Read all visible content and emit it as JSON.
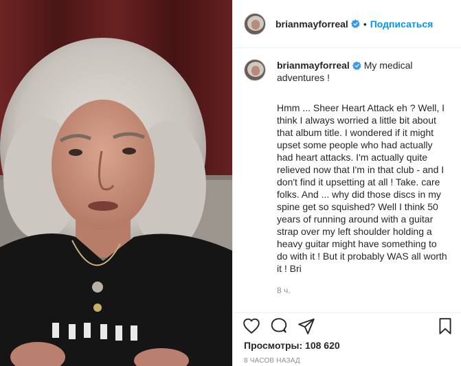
{
  "post": {
    "username": "brianmayforreal",
    "follow_label": "Подписаться",
    "separator": "•",
    "caption_title": "My medical adventures !",
    "caption_text": "Hmm ... Sheer Heart Attack eh ? Well, I think I always worried a little bit about that album title. I wondered if it might upset some people who had actually had heart attacks. I'm actually quite relieved now that I'm in that club - and I don't find it upsetting at all ! Take. care folks. And ... why did those discs in my spine get so squished? Well I think 50 years of running around with a guitar strap over my left shoulder holding a heavy guitar might have something to do with it ! But it probably WAS all worth it ! Bri",
    "caption_time": "8 ч.",
    "views": "Просмотры: 108 620",
    "posted_ago": "8 часов назад"
  },
  "icons": {
    "verified": "verified-badge-icon",
    "like": "heart-icon",
    "comment": "comment-bubble-icon",
    "share": "paper-plane-icon",
    "save": "bookmark-icon"
  },
  "colors": {
    "accent": "#0095f6",
    "text": "#262626",
    "muted": "#8e8e8e",
    "border": "#efefef"
  }
}
